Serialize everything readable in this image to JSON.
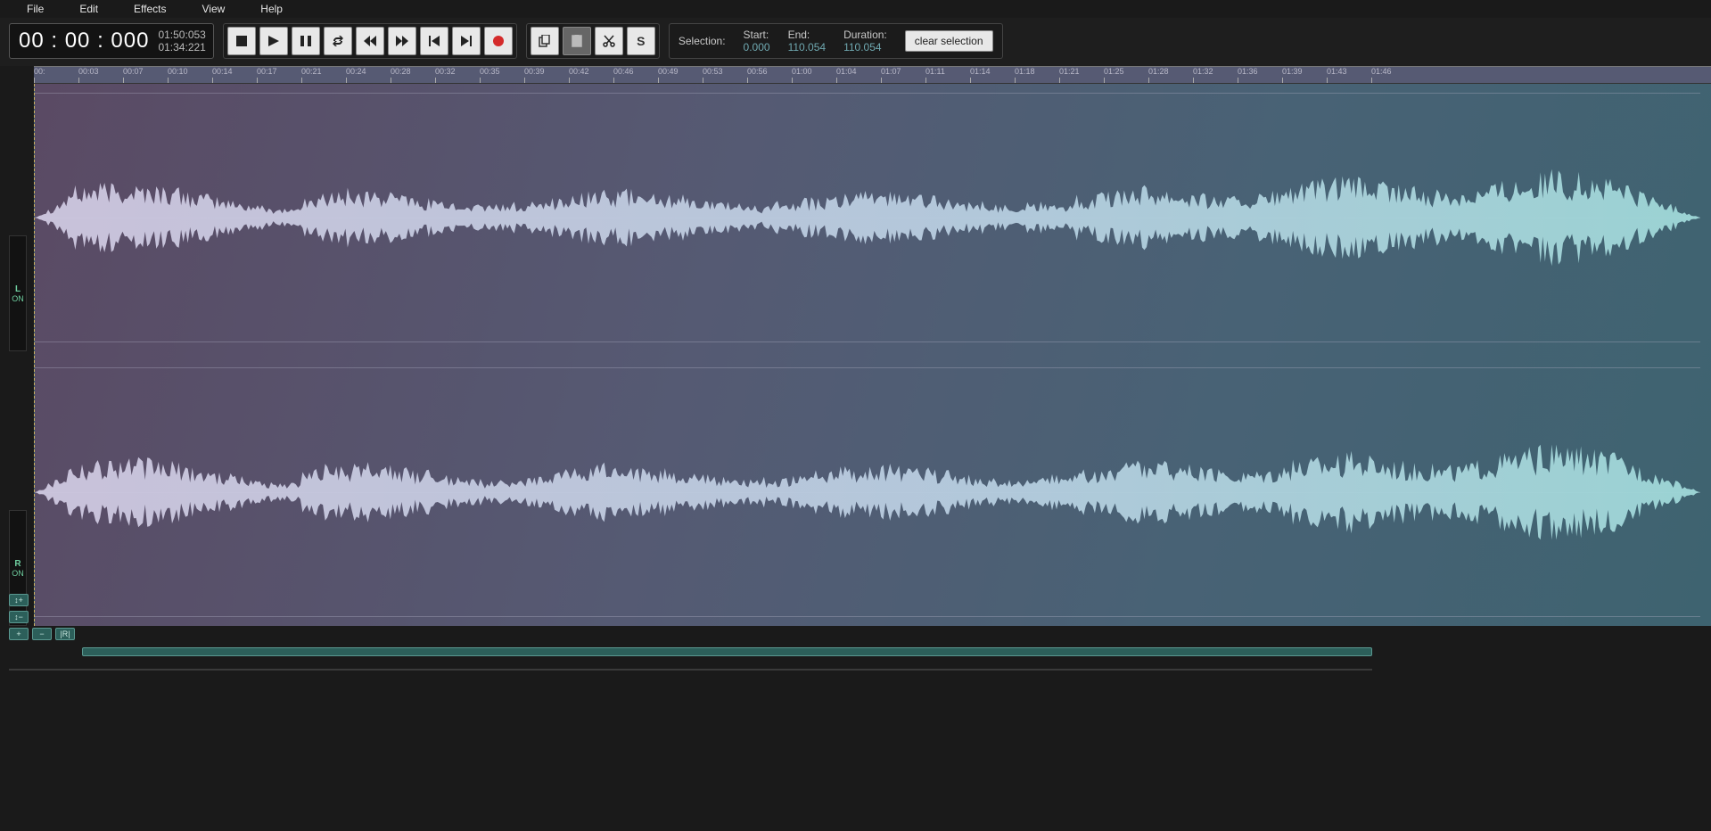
{
  "menu": {
    "items": [
      "File",
      "Edit",
      "Effects",
      "View",
      "Help"
    ]
  },
  "time": {
    "main": "00 : 00 : 000",
    "sub1": "01:50:053",
    "sub2": "01:34:221"
  },
  "transport": {
    "stop": "stop",
    "play": "play",
    "pause": "pause",
    "loop": "loop",
    "rewind": "rewind",
    "forward": "forward",
    "prev": "prev",
    "next": "next",
    "record": "record"
  },
  "edit": {
    "copy": "copy",
    "paste": "paste",
    "cut": "cut",
    "snap": "S"
  },
  "selection": {
    "label": "Selection:",
    "start_k": "Start:",
    "start_v": "0.000",
    "end_k": "End:",
    "end_v": "110.054",
    "dur_k": "Duration:",
    "dur_v": "110.054",
    "clear": "clear selection"
  },
  "ruler": {
    "ticks": [
      "00:",
      "00:03",
      "00:07",
      "00:10",
      "00:14",
      "00:17",
      "00:21",
      "00:24",
      "00:28",
      "00:32",
      "00:35",
      "00:39",
      "00:42",
      "00:46",
      "00:49",
      "00:53",
      "00:56",
      "01:00",
      "01:04",
      "01:07",
      "01:11",
      "01:14",
      "01:18",
      "01:21",
      "01:25",
      "01:28",
      "01:32",
      "01:36",
      "01:39",
      "01:43",
      "01:46"
    ]
  },
  "channels": {
    "l": "L",
    "r": "R",
    "on": "ON"
  },
  "zoom": {
    "vin": "↕+",
    "vout": "↕−",
    "hin": "+",
    "hout": "−",
    "fit": "|R|"
  }
}
